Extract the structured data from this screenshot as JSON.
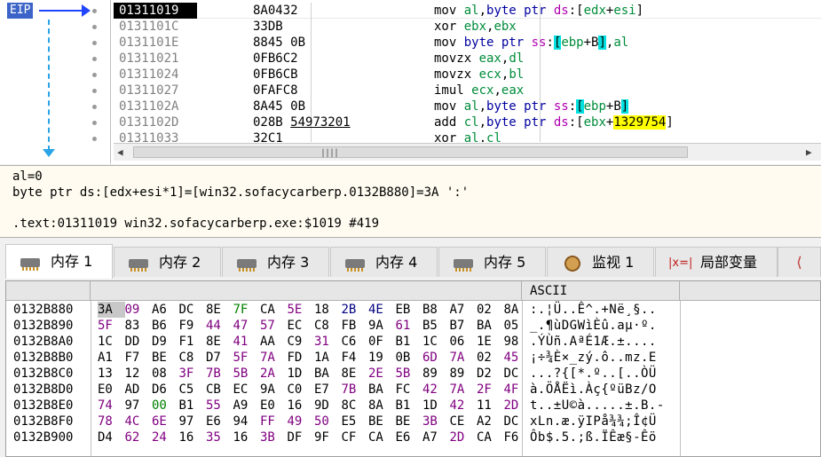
{
  "gutter": {
    "eip_label": "EIP"
  },
  "disasm": {
    "rows": [
      {
        "addr": "01311019",
        "bytes": "8A0432",
        "instr": [
          [
            "mn",
            "mov "
          ],
          [
            "reg",
            "al"
          ],
          [
            "mn",
            ","
          ],
          [
            "sz",
            "byte ptr "
          ],
          [
            "seg",
            "ds"
          ],
          [
            "mn",
            ":["
          ],
          [
            "reg",
            "edx"
          ],
          [
            "mn",
            "+"
          ],
          [
            "reg",
            "esi"
          ],
          [
            "mn",
            "]"
          ]
        ]
      },
      {
        "addr": "0131101C",
        "bytes": "33DB",
        "instr": [
          [
            "mn",
            "xor "
          ],
          [
            "reg",
            "ebx"
          ],
          [
            "mn",
            ","
          ],
          [
            "reg",
            "ebx"
          ]
        ]
      },
      {
        "addr": "0131101E",
        "bytes": "8845 0B",
        "instr": [
          [
            "mn",
            "mov "
          ],
          [
            "sz",
            "byte ptr "
          ],
          [
            "seg",
            "ss"
          ],
          [
            "mn",
            ":"
          ],
          [
            "hlc",
            "["
          ],
          [
            "reg",
            "ebp"
          ],
          [
            "mn",
            "+B"
          ],
          [
            "hlc",
            "]"
          ],
          [
            "mn",
            ","
          ],
          [
            "reg",
            "al"
          ]
        ]
      },
      {
        "addr": "01311021",
        "bytes": "0FB6C2",
        "instr": [
          [
            "mn",
            "movzx "
          ],
          [
            "reg",
            "eax"
          ],
          [
            "mn",
            ","
          ],
          [
            "reg",
            "dl"
          ]
        ]
      },
      {
        "addr": "01311024",
        "bytes": "0FB6CB",
        "instr": [
          [
            "mn",
            "movzx "
          ],
          [
            "reg",
            "ecx"
          ],
          [
            "mn",
            ","
          ],
          [
            "reg",
            "bl"
          ]
        ]
      },
      {
        "addr": "01311027",
        "bytes": "0FAFC8",
        "instr": [
          [
            "mn",
            "imul "
          ],
          [
            "reg",
            "ecx"
          ],
          [
            "mn",
            ","
          ],
          [
            "reg",
            "eax"
          ]
        ]
      },
      {
        "addr": "0131102A",
        "bytes": "8A45 0B",
        "instr": [
          [
            "mn",
            "mov "
          ],
          [
            "reg",
            "al"
          ],
          [
            "mn",
            ","
          ],
          [
            "sz",
            "byte ptr "
          ],
          [
            "seg",
            "ss"
          ],
          [
            "mn",
            ":"
          ],
          [
            "hlc",
            "["
          ],
          [
            "reg",
            "ebp"
          ],
          [
            "mn",
            "+B"
          ],
          [
            "hlc",
            "]"
          ]
        ]
      },
      {
        "addr": "0131102D",
        "bytes": "028B",
        "bytes_ul": "54973201",
        "instr": [
          [
            "mn",
            "add "
          ],
          [
            "reg",
            "cl"
          ],
          [
            "mn",
            ","
          ],
          [
            "sz",
            "byte ptr "
          ],
          [
            "seg",
            "ds"
          ],
          [
            "mn",
            ":["
          ],
          [
            "reg",
            "ebx"
          ],
          [
            "mn",
            "+"
          ],
          [
            "hly",
            "1329754"
          ],
          [
            "mn",
            "]"
          ]
        ]
      },
      {
        "addr": "01311033",
        "bytes": "32C1",
        "instr": [
          [
            "mn",
            "xor "
          ],
          [
            "reg",
            "al"
          ],
          [
            "mn",
            ","
          ],
          [
            "reg",
            "cl"
          ]
        ]
      }
    ]
  },
  "info": {
    "line1": "al=0",
    "line2": "byte ptr ds:[edx+esi*1]=[win32.sofacycarberp.0132B880]=3A ':'",
    "line3": ".text:01311019 win32.sofacycarberp.exe:$1019 #419"
  },
  "tabs": [
    {
      "label": "内存 1",
      "icon": "memory-icon",
      "active": true
    },
    {
      "label": "内存 2",
      "icon": "memory-icon"
    },
    {
      "label": "内存 3",
      "icon": "memory-icon"
    },
    {
      "label": "内存 4",
      "icon": "memory-icon"
    },
    {
      "label": "内存 5",
      "icon": "memory-icon"
    },
    {
      "label": "监视 1",
      "icon": "watch-icon"
    },
    {
      "label": "局部变量",
      "icon": "local-vars-icon"
    }
  ],
  "dump": {
    "ascii_header": "ASCII",
    "rows": [
      {
        "addr": "0132B880",
        "hex": [
          [
            "3A",
            0
          ],
          [
            "09",
            1
          ],
          [
            "A6",
            0
          ],
          [
            "DC",
            0
          ],
          [
            "8E",
            0
          ],
          [
            "7F",
            2
          ],
          [
            "CA",
            0
          ],
          [
            "5E",
            1
          ],
          [
            "18",
            0
          ],
          [
            "2B",
            3
          ],
          [
            "4E",
            3
          ],
          [
            "EB",
            0
          ],
          [
            "B8",
            0
          ],
          [
            "A7",
            0
          ],
          [
            "02",
            0
          ],
          [
            "8A",
            0
          ]
        ],
        "ascii": ":.¦Ü..Ê^.+Në¸§.."
      },
      {
        "addr": "0132B890",
        "hex": [
          [
            "5F",
            1
          ],
          [
            "83",
            0
          ],
          [
            "B6",
            0
          ],
          [
            "F9",
            0
          ],
          [
            "44",
            1
          ],
          [
            "47",
            1
          ],
          [
            "57",
            1
          ],
          [
            "EC",
            0
          ],
          [
            "C8",
            0
          ],
          [
            "FB",
            0
          ],
          [
            "9A",
            0
          ],
          [
            "61",
            1
          ],
          [
            "B5",
            0
          ],
          [
            "B7",
            0
          ],
          [
            "BA",
            0
          ],
          [
            "05",
            0
          ]
        ],
        "ascii": "_.¶ùDGWìÈû.aµ·º."
      },
      {
        "addr": "0132B8A0",
        "hex": [
          [
            "1C",
            0
          ],
          [
            "DD",
            0
          ],
          [
            "D9",
            0
          ],
          [
            "F1",
            0
          ],
          [
            "8E",
            0
          ],
          [
            "41",
            1
          ],
          [
            "AA",
            0
          ],
          [
            "C9",
            0
          ],
          [
            "31",
            1
          ],
          [
            "C6",
            0
          ],
          [
            "0F",
            0
          ],
          [
            "B1",
            0
          ],
          [
            "1C",
            0
          ],
          [
            "06",
            0
          ],
          [
            "1E",
            0
          ],
          [
            "98",
            0
          ]
        ],
        "ascii": ".ÝÙñ.AªÉ1Æ.±...."
      },
      {
        "addr": "0132B8B0",
        "hex": [
          [
            "A1",
            0
          ],
          [
            "F7",
            0
          ],
          [
            "BE",
            0
          ],
          [
            "C8",
            0
          ],
          [
            "D7",
            0
          ],
          [
            "5F",
            1
          ],
          [
            "7A",
            1
          ],
          [
            "FD",
            0
          ],
          [
            "1A",
            0
          ],
          [
            "F4",
            0
          ],
          [
            "19",
            0
          ],
          [
            "0B",
            0
          ],
          [
            "6D",
            1
          ],
          [
            "7A",
            1
          ],
          [
            "02",
            0
          ],
          [
            "45",
            1
          ]
        ],
        "ascii": "¡÷¾È×_zý.ô..mz.E"
      },
      {
        "addr": "0132B8C0",
        "hex": [
          [
            "13",
            0
          ],
          [
            "12",
            0
          ],
          [
            "08",
            0
          ],
          [
            "3F",
            1
          ],
          [
            "7B",
            1
          ],
          [
            "5B",
            1
          ],
          [
            "2A",
            1
          ],
          [
            "1D",
            0
          ],
          [
            "BA",
            0
          ],
          [
            "8E",
            0
          ],
          [
            "2E",
            1
          ],
          [
            "5B",
            1
          ],
          [
            "89",
            0
          ],
          [
            "89",
            0
          ],
          [
            "D2",
            0
          ],
          [
            "DC",
            0
          ]
        ],
        "ascii": "...?{[*.º..[..ÒÜ"
      },
      {
        "addr": "0132B8D0",
        "hex": [
          [
            "E0",
            0
          ],
          [
            "AD",
            0
          ],
          [
            "D6",
            0
          ],
          [
            "C5",
            0
          ],
          [
            "CB",
            0
          ],
          [
            "EC",
            0
          ],
          [
            "9A",
            0
          ],
          [
            "C0",
            0
          ],
          [
            "E7",
            0
          ],
          [
            "7B",
            1
          ],
          [
            "BA",
            0
          ],
          [
            "FC",
            0
          ],
          [
            "42",
            1
          ],
          [
            "7A",
            1
          ],
          [
            "2F",
            1
          ],
          [
            "4F",
            1
          ]
        ],
        "ascii": "à.ÖÅËì.Àç{ºüBz/O"
      },
      {
        "addr": "0132B8E0",
        "hex": [
          [
            "74",
            1
          ],
          [
            "97",
            0
          ],
          [
            "00",
            2
          ],
          [
            "B1",
            0
          ],
          [
            "55",
            1
          ],
          [
            "A9",
            0
          ],
          [
            "E0",
            0
          ],
          [
            "16",
            0
          ],
          [
            "9D",
            0
          ],
          [
            "8C",
            0
          ],
          [
            "8A",
            0
          ],
          [
            "B1",
            0
          ],
          [
            "1D",
            0
          ],
          [
            "42",
            1
          ],
          [
            "11",
            0
          ],
          [
            "2D",
            1
          ]
        ],
        "ascii": "t..±U©à.....±.B.-"
      },
      {
        "addr": "0132B8F0",
        "hex": [
          [
            "78",
            1
          ],
          [
            "4C",
            1
          ],
          [
            "6E",
            1
          ],
          [
            "97",
            0
          ],
          [
            "E6",
            0
          ],
          [
            "94",
            0
          ],
          [
            "FF",
            1
          ],
          [
            "49",
            1
          ],
          [
            "50",
            1
          ],
          [
            "E5",
            0
          ],
          [
            "BE",
            0
          ],
          [
            "BE",
            0
          ],
          [
            "3B",
            1
          ],
          [
            "CE",
            0
          ],
          [
            "A2",
            0
          ],
          [
            "DC",
            0
          ]
        ],
        "ascii": "xLn.æ.ÿIPå¾¾;Î¢Ü"
      },
      {
        "addr": "0132B900",
        "hex": [
          [
            "D4",
            0
          ],
          [
            "62",
            1
          ],
          [
            "24",
            1
          ],
          [
            "16",
            0
          ],
          [
            "35",
            1
          ],
          [
            "16",
            0
          ],
          [
            "3B",
            1
          ],
          [
            "DF",
            0
          ],
          [
            "9F",
            0
          ],
          [
            "CF",
            0
          ],
          [
            "CA",
            0
          ],
          [
            "E6",
            0
          ],
          [
            "A7",
            0
          ],
          [
            "2D",
            1
          ],
          [
            "CA",
            0
          ],
          [
            "F6",
            0
          ]
        ],
        "ascii": "Ôb$.5.;ß.ÏÊæ§-Êö"
      }
    ]
  }
}
